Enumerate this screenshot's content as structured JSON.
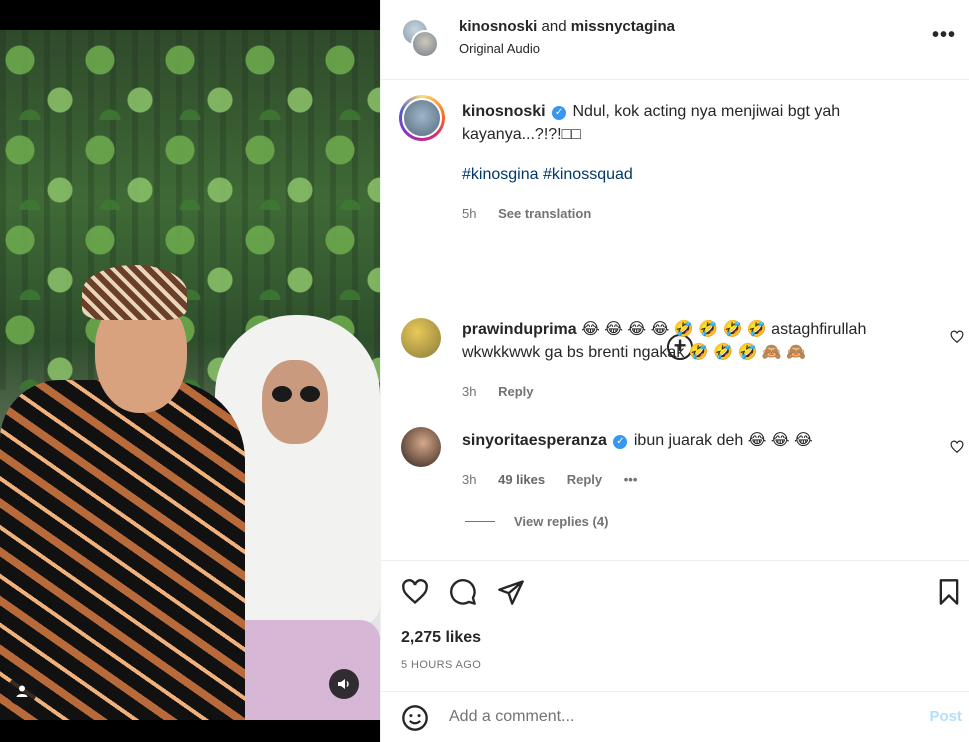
{
  "header": {
    "user1": "kinosnoski",
    "joiner": "and",
    "user2": "missnyctagina",
    "audio": "Original Audio"
  },
  "caption": {
    "username": "kinosnoski",
    "text": "Ndul, kok acting nya menjiwai bgt yah kayanya...?!?!□□",
    "hashtags": "#kinosgina #kinossquad",
    "time": "5h",
    "translation": "See translation"
  },
  "comments": [
    {
      "username": "prawinduprima",
      "text": "😂 😂 😂 😂 🤣 🤣 🤣 🤣 astaghfirullah wkwkkwwk ga bs brenti ngakak 🤣 🤣 🤣 🙈 🙈",
      "time": "3h",
      "reply": "Reply"
    },
    {
      "username": "sinyoritaesperanza",
      "text": "ibun juarak deh 😂 😂 😂",
      "time": "3h",
      "likes": "49 likes",
      "reply": "Reply",
      "view_replies": "View replies (4)"
    }
  ],
  "post": {
    "likes": "2,275 likes",
    "time": "5 HOURS AGO"
  },
  "composer": {
    "placeholder": "Add a comment...",
    "post_label": "Post"
  },
  "colors": {
    "link": "#00376b",
    "verified": "#3897f0",
    "post_disabled": "#b2dffc",
    "muted": "#737373"
  },
  "icons": [
    "user-icon",
    "sound-icon",
    "more-icon",
    "verified-icon",
    "add-circle-icon",
    "heart-icon",
    "comment-icon",
    "share-icon",
    "bookmark-icon",
    "emoji-icon"
  ]
}
